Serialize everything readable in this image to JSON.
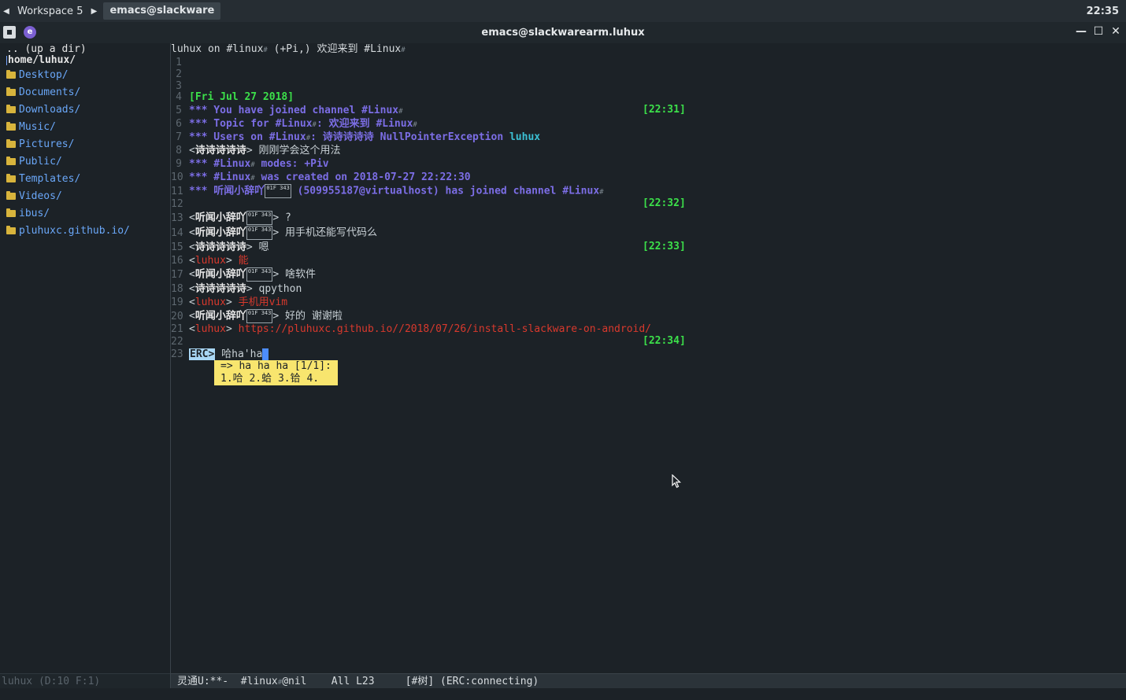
{
  "panel": {
    "workspace": "Workspace 5",
    "task": "emacs@slackware",
    "clock": "22:35"
  },
  "window": {
    "title": "emacs@slackwarearm.luhux"
  },
  "sidebar": {
    "updir": ".. (up a dir)",
    "home": "home/luhux/",
    "dirs": [
      "Desktop/",
      "Documents/",
      "Downloads/",
      "Music/",
      "Pictures/",
      "Public/",
      "Templates/",
      "Videos/",
      "ibus/",
      "pluhuxc.github.io/"
    ]
  },
  "buffer": {
    "header_nick": "luhux on #linux",
    "header_mode": " (+Pi,) 欢迎来到 #Linux",
    "date": "[Fri Jul 27 2018]",
    "joined": "*** You have joined channel #Linux",
    "topic_a": "*** Topic for #Linux",
    "topic_b": ": 欢迎来到 #Linux",
    "users_a": "*** Users on #Linux",
    "users_b": ": 诗诗诗诗诗 NullPointerException ",
    "users_c": "luhux",
    "l8_nick": "诗诗诗诗诗",
    "l8_msg": "  刚刚学会这个用法",
    "l9_a": "*** #Linux",
    "l9_b": " modes: +Piv",
    "l10_a": "*** #Linux",
    "l10_b": " was created on 2018-07-27 22:22:30",
    "l11_a": "*** 听闻小辞吖",
    "l11_b": " (509955187@virtualhost) has joined channel #Linux",
    "n2": "听闻小辞吖",
    "box": "01F 343",
    "l13_msg": " ?",
    "l14_msg": "   用手机还能写代码么",
    "l15_msg": " 嗯",
    "me": "luhux",
    "l16_msg": " 能",
    "l17_msg": " 啥软件",
    "l18_msg": " qpython",
    "l19_msg": " 手机用vim",
    "l20_msg": "  好的 谢谢啦",
    "l21_msg": " https://pluhuxc.github.io//2018/07/26/install-slackware-on-android/",
    "prompt": "ERC>",
    "input": " 哈ha'ha",
    "popup_line1": "=> ha ha ha [1/1]:",
    "popup_line2": "1.哈 2.蛤 3.铪 4.",
    "stamps": [
      "[22:31]",
      "[22:32]",
      "[22:33]",
      "[22:34]"
    ]
  },
  "modeline": {
    "left": "luhux (D:10 F:1)",
    "main_a": "灵通U:**-  ",
    "main_b": "#linux",
    "main_c": "@nil    All L23     [#树] (ERC:connecting)"
  },
  "colors": {
    "timestamp": "#3ce04a",
    "notice": "#7c6ee6",
    "self_nick": "#d8392d",
    "directory": "#6aa7f8"
  }
}
